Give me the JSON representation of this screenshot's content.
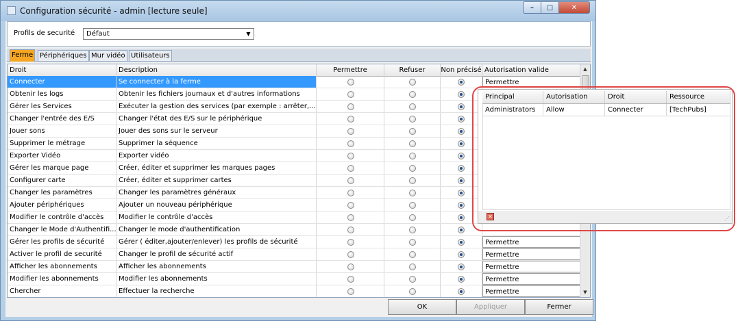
{
  "window": {
    "title": "Configuration sécurité - admin [lecture seule]",
    "controls": {
      "minimize": "–",
      "maximize": "□",
      "close": "✕"
    }
  },
  "profile": {
    "label": "Profils de securité",
    "value": "Défaut"
  },
  "tabs": [
    {
      "label": "Ferme",
      "active": true
    },
    {
      "label": "Périphériques",
      "active": false
    },
    {
      "label": "Mur vidéo",
      "active": false
    },
    {
      "label": "Utilisateurs",
      "active": false
    }
  ],
  "grid": {
    "headers": {
      "droit": "Droit",
      "description": "Description",
      "permettre": "Permettre",
      "refuser": "Refuser",
      "non_precise": "Non précisé",
      "autorisation": "Autorisation valide"
    },
    "rows": [
      {
        "droit": "Connecter",
        "description": "Se connecter à la ferme",
        "choice": "non_precise",
        "auth": "Permettre",
        "selected": true
      },
      {
        "droit": "Obtenir les logs",
        "description": "Obtenir les fichiers journaux et d'autres informations",
        "choice": "non_precise",
        "auth": "",
        "selected": false
      },
      {
        "droit": "Gérer les Services",
        "description": "Exécuter la gestion des services (par exemple : arrêter,...",
        "choice": "non_precise",
        "auth": "",
        "selected": false
      },
      {
        "droit": "Changer l'entrée des E/S",
        "description": "Changer l'état des E/S sur le périphérique",
        "choice": "non_precise",
        "auth": "",
        "selected": false
      },
      {
        "droit": "Jouer sons",
        "description": "Jouer des sons sur le serveur",
        "choice": "non_precise",
        "auth": "",
        "selected": false
      },
      {
        "droit": "Supprimer le métrage",
        "description": "Supprimer la séquence",
        "choice": "non_precise",
        "auth": "",
        "selected": false
      },
      {
        "droit": "Exporter Vidéo",
        "description": "Exporter vidéo",
        "choice": "non_precise",
        "auth": "",
        "selected": false
      },
      {
        "droit": "Gérer les marque page",
        "description": "Créer, éditer et supprimer les marques pages",
        "choice": "non_precise",
        "auth": "",
        "selected": false
      },
      {
        "droit": "Configurer carte",
        "description": "Créer, éditer et supprimer cartes",
        "choice": "non_precise",
        "auth": "",
        "selected": false
      },
      {
        "droit": "Changer les paramètres",
        "description": "Changer les paramètres généraux",
        "choice": "non_precise",
        "auth": "",
        "selected": false
      },
      {
        "droit": "Ajouter périphériques",
        "description": "Ajouter un nouveau périphérique",
        "choice": "non_precise",
        "auth": "",
        "selected": false
      },
      {
        "droit": "Modifier le contrôle d'accès",
        "description": "Modifier le contrôle d'accès",
        "choice": "non_precise",
        "auth": "",
        "selected": false
      },
      {
        "droit": "Changer le Mode d'Authentifi...",
        "description": "Changer le mode d'authentification",
        "choice": "non_precise",
        "auth": "",
        "selected": false
      },
      {
        "droit": "Gérer les profils de sécurité",
        "description": "Gérer ( éditer,ajouter/enlever) les profils de sécurité",
        "choice": "non_precise",
        "auth": "Permettre",
        "selected": false
      },
      {
        "droit": "Activer le profil de securité",
        "description": "Changer le profil de sécurité actif",
        "choice": "non_precise",
        "auth": "Permettre",
        "selected": false
      },
      {
        "droit": "Afficher les abonnements",
        "description": "Afficher les abonnements",
        "choice": "non_precise",
        "auth": "Permettre",
        "selected": false
      },
      {
        "droit": "Modifier les abonnements",
        "description": "Modifier les abonnements",
        "choice": "non_precise",
        "auth": "Permettre",
        "selected": false
      },
      {
        "droit": "Chercher",
        "description": "Effectuer la recherche",
        "choice": "non_precise",
        "auth": "Permettre",
        "selected": false
      }
    ]
  },
  "buttons": {
    "ok": "OK",
    "apply": "Appliquer",
    "close": "Fermer"
  },
  "popup": {
    "headers": {
      "principal": "Principal",
      "autorisation": "Autorisation",
      "droit": "Droit",
      "ressource": "Ressource"
    },
    "rows": [
      {
        "principal": "Administrators",
        "autorisation": "Allow",
        "droit": "Connecter",
        "ressource": "[TechPubs]"
      }
    ],
    "close_icon": "✕"
  },
  "colors": {
    "active_tab": "#f5a623",
    "selection": "#3399ff",
    "highlight": "#e04646"
  }
}
